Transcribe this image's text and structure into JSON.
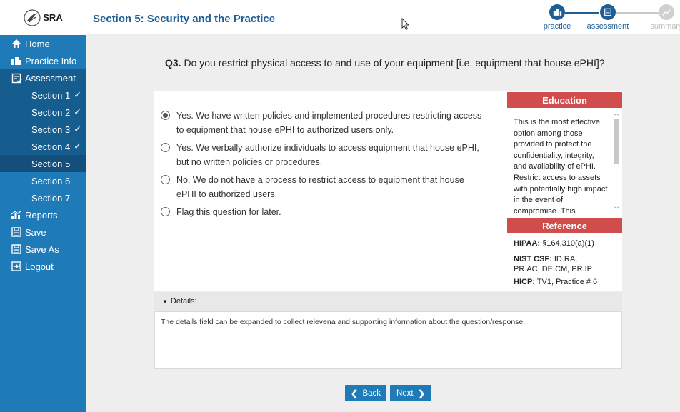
{
  "app": {
    "logo_text": "SRA"
  },
  "sidebar": {
    "items": [
      {
        "label": "Home",
        "icon": "home-icon"
      },
      {
        "label": "Practice Info",
        "icon": "building-icon"
      },
      {
        "label": "Assessment",
        "icon": "clipboard-icon"
      },
      {
        "label": "Section 1",
        "done": "✓"
      },
      {
        "label": "Section 2",
        "done": "✓"
      },
      {
        "label": "Section 3",
        "done": "✓"
      },
      {
        "label": "Section 4",
        "done": "✓"
      },
      {
        "label": "Section 5"
      },
      {
        "label": "Section 6"
      },
      {
        "label": "Section 7"
      },
      {
        "label": "Reports",
        "icon": "chart-icon"
      },
      {
        "label": "Save",
        "icon": "save-icon"
      },
      {
        "label": "Save As",
        "icon": "save-as-icon"
      },
      {
        "label": "Logout",
        "icon": "logout-icon"
      }
    ]
  },
  "header": {
    "title": "Section 5: Security and the Practice",
    "steps": [
      {
        "label": "practice",
        "state": "active"
      },
      {
        "label": "assessment",
        "state": "active"
      },
      {
        "label": "summary",
        "state": "inactive"
      }
    ]
  },
  "question": {
    "number": "Q3.",
    "text": " Do you restrict physical access to and use of your equipment [i.e. equipment that house ePHI]?"
  },
  "options": [
    {
      "line1": "Yes. We have written policies and implemented procedures restricting access",
      "line2": "to equipment that house ePHI to authorized users only.",
      "checked": true
    },
    {
      "line1": "Yes. We verbally authorize individuals to access equipment that house ePHI,",
      "line2": "but no written policies or procedures.",
      "checked": false
    },
    {
      "line1": "No. We do not have a process to restrict access to equipment that house",
      "line2": "ePHI to authorized users.",
      "checked": false
    },
    {
      "line1": "Flag this question for later.",
      "line2": "",
      "checked": false
    }
  ],
  "education": {
    "title": "Education",
    "text": "This is the most effective option among those provided to protect the confidentiality, integrity, and availability of ePHI. Restrict access to assets with potentially high impact in the event of compromise. This"
  },
  "reference": {
    "title": "Reference",
    "hipaa_label": "HIPAA:",
    "hipaa_value": " §164.310(a)(1)",
    "nist_label": "NIST CSF:",
    "nist_value": " ID.RA, PR.AC, DE.CM, PR.IP",
    "hicp_label": "HICP:",
    "hicp_value": " TV1, Practice # 6"
  },
  "details": {
    "label": "Details:",
    "text": "The details field can be expanded to collect relevena and supporting information about the question/response."
  },
  "nav_buttons": {
    "back": "Back",
    "next": "Next"
  },
  "colors": {
    "brand": "#1f7ab8",
    "accent_red": "#d14d4d",
    "title": "#1e5e96"
  }
}
